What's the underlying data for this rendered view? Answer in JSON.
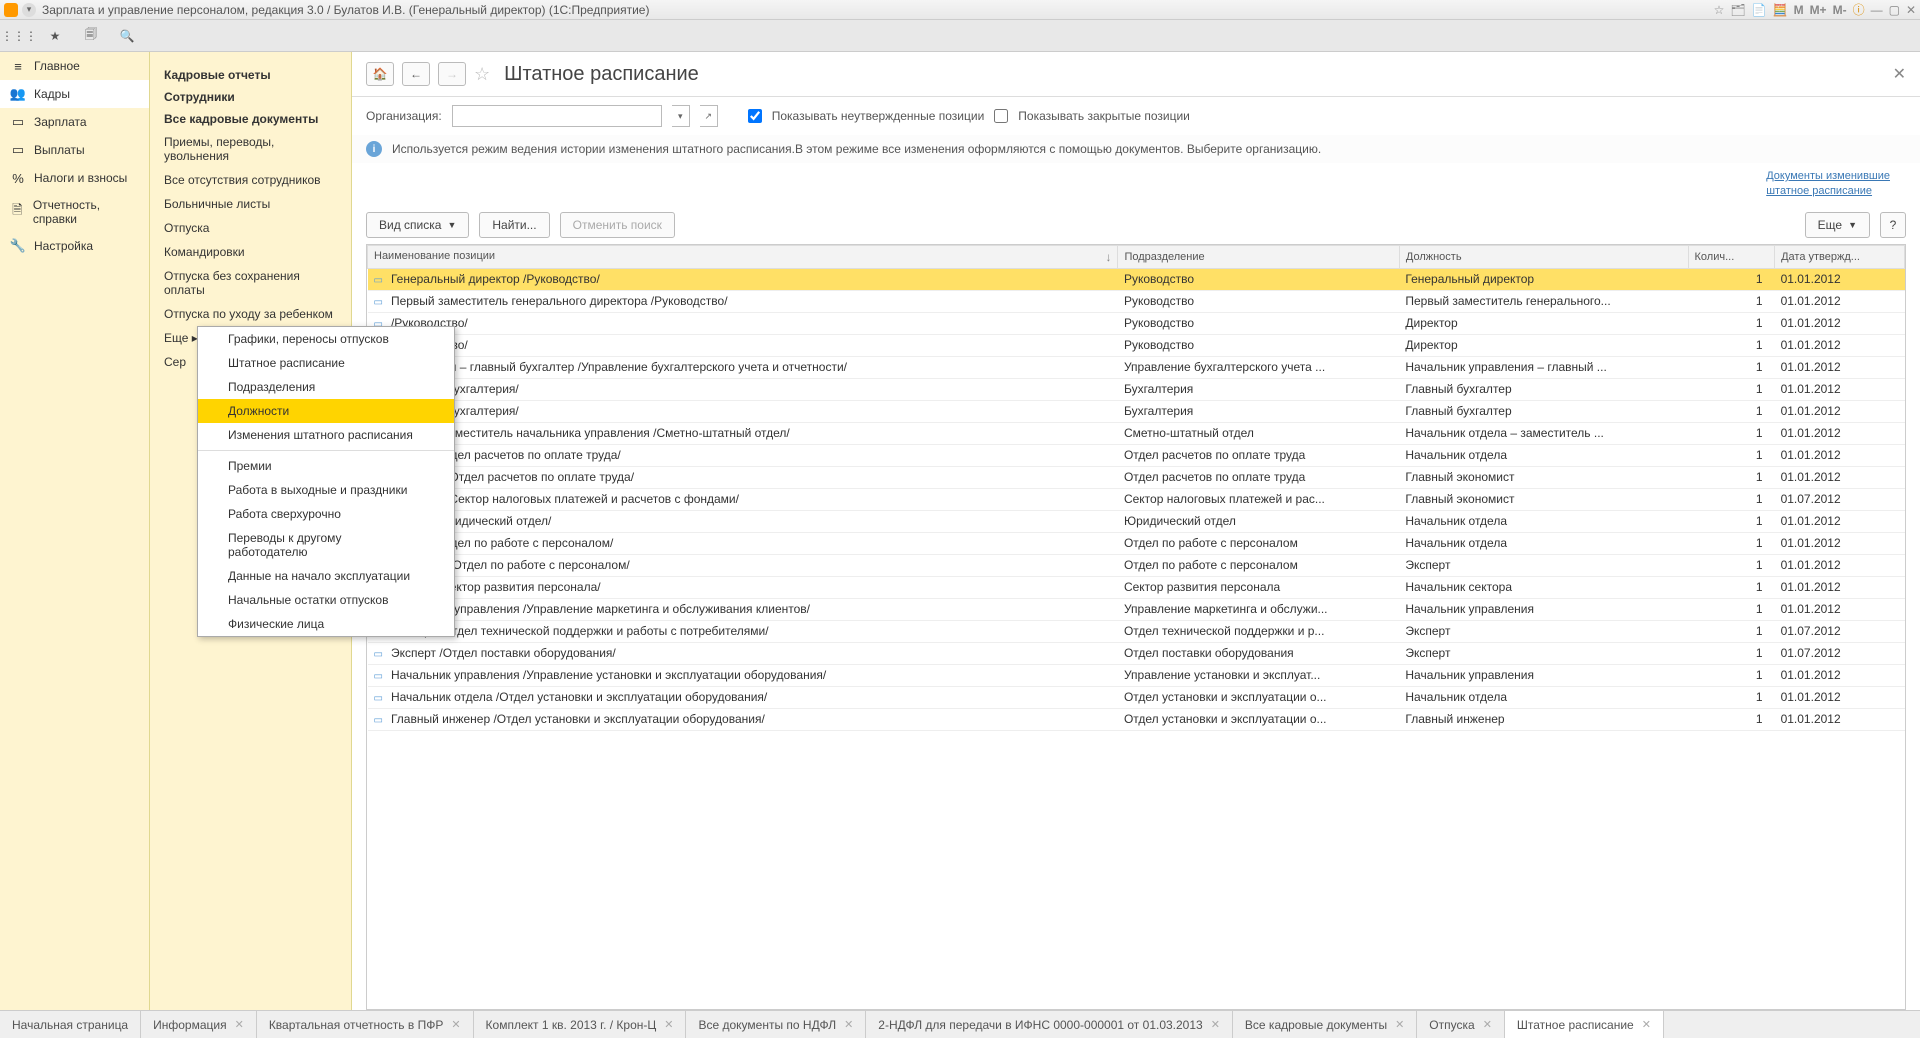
{
  "title": "Зарплата и управление персоналом, редакция 3.0 / Булатов И.В. (Генеральный директор)  (1С:Предприятие)",
  "leftnav": [
    {
      "icon": "≡",
      "label": "Главное"
    },
    {
      "icon": "👥",
      "label": "Кадры"
    },
    {
      "icon": "▭",
      "label": "Зарплата"
    },
    {
      "icon": "▭",
      "label": "Выплаты"
    },
    {
      "icon": "%",
      "label": "Налоги и взносы"
    },
    {
      "icon": "🗎",
      "label": "Отчетность, справки"
    },
    {
      "icon": "🔧",
      "label": "Настройка"
    }
  ],
  "subnav": {
    "headers": [
      "Кадровые отчеты",
      "Сотрудники",
      "Все кадровые документы"
    ],
    "links": [
      "Приемы, переводы, увольнения",
      "Все отсутствия сотрудников",
      "Больничные листы",
      "Отпуска",
      "Командировки",
      "Отпуска без сохранения оплаты",
      "Отпуска по уходу за ребенком",
      "Еще  ▸",
      "Сер"
    ]
  },
  "ctxmenu": {
    "items": [
      "Графики, переносы отпусков",
      "Штатное расписание",
      "Подразделения",
      "Должности",
      "Изменения штатного расписания",
      "—",
      "Премии",
      "Работа в выходные и праздники",
      "Работа сверхурочно",
      "Переводы к другому работодателю",
      "Данные на начало эксплуатации",
      "Начальные остатки отпусков",
      "Физические лица"
    ],
    "highlight": 3
  },
  "page": {
    "title": "Штатное расписание",
    "org_label": "Организация:",
    "show_unapproved": "Показывать неутвержденные позиции",
    "show_closed": "Показывать закрытые позиции",
    "info": "Используется режим ведения истории изменения штатного расписания.В этом режиме все изменения оформляются с помощью документов. Выберите организацию.",
    "doclink": "Документы изменившие\nштатное расписание",
    "btn_view": "Вид списка",
    "btn_find": "Найти...",
    "btn_cancel": "Отменить поиск",
    "btn_more": "Еще",
    "cols": [
      "Наименование позиции",
      "Подразделение",
      "Должность",
      "Колич...",
      "Дата утвержд..."
    ]
  },
  "rows": [
    {
      "name": "Генеральный директор /Руководство/",
      "dept": "Руководство",
      "pos": "Генеральный директор",
      "qty": "1",
      "date": "01.01.2012",
      "sel": true
    },
    {
      "name": "Первый заместитель генерального директора /Руководство/",
      "dept": "Руководство",
      "pos": "Первый заместитель генерального...",
      "qty": "1",
      "date": "01.01.2012"
    },
    {
      "name": "/Руководство/",
      "dept": "Руководство",
      "pos": "Директор",
      "qty": "1",
      "date": "01.01.2012"
    },
    {
      "name": "/Руководство/",
      "dept": "Руководство",
      "pos": "Директор",
      "qty": "1",
      "date": "01.01.2012"
    },
    {
      "name": "управления – главный бухгалтер /Управление бухгалтерского учета и отчетности/",
      "dept": "Управление бухгалтерского учета ...",
      "pos": "Начальник управления – главный ...",
      "qty": "1",
      "date": "01.01.2012"
    },
    {
      "name": "ухгалтер /Бухгалтерия/",
      "dept": "Бухгалтерия",
      "pos": "Главный бухгалтер",
      "qty": "1",
      "date": "01.01.2012"
    },
    {
      "name": "ухгалтер /Бухгалтерия/",
      "dept": "Бухгалтерия",
      "pos": "Главный бухгалтер",
      "qty": "1",
      "date": "01.01.2012"
    },
    {
      "name": "отдела – заместитель начальника управления /Сметно-штатный отдел/",
      "dept": "Сметно-штатный отдел",
      "pos": "Начальник отдела – заместитель ...",
      "qty": "1",
      "date": "01.01.2012"
    },
    {
      "name": "отдела /Отдел расчетов по оплате труда/",
      "dept": "Отдел расчетов по оплате труда",
      "pos": "Начальник отдела",
      "qty": "1",
      "date": "01.01.2012"
    },
    {
      "name": "кономист /Отдел расчетов по оплате труда/",
      "dept": "Отдел расчетов по оплате труда",
      "pos": "Главный экономист",
      "qty": "1",
      "date": "01.01.2012"
    },
    {
      "name": "кономист /Сектор налоговых платежей и расчетов с фондами/",
      "dept": "Сектор налоговых платежей и рас...",
      "pos": "Главный экономист",
      "qty": "1",
      "date": "01.07.2012"
    },
    {
      "name": "отдела /Юридический отдел/",
      "dept": "Юридический отдел",
      "pos": "Начальник отдела",
      "qty": "1",
      "date": "01.01.2012"
    },
    {
      "name": "отдела /Отдел по работе с персоналом/",
      "dept": "Отдел по работе с персоналом",
      "pos": "Начальник отдела",
      "qty": "1",
      "date": "01.01.2012"
    },
    {
      "name": "категории /Отдел по работе с персоналом/",
      "dept": "Отдел по работе с персоналом",
      "pos": "Эксперт",
      "qty": "1",
      "date": "01.01.2012"
    },
    {
      "name": "сектора /Сектор развития персонала/",
      "dept": "Сектор развития персонала",
      "pos": "Начальник сектора",
      "qty": "1",
      "date": "01.01.2012"
    },
    {
      "name": "Начальник управления /Управление маркетинга и обслуживания клиентов/",
      "dept": "Управление маркетинга и обслужи...",
      "pos": "Начальник управления",
      "qty": "1",
      "date": "01.01.2012"
    },
    {
      "name": "Эксперт /Отдел технической поддержки и работы с потребителями/",
      "dept": "Отдел технической поддержки и р...",
      "pos": "Эксперт",
      "qty": "1",
      "date": "01.07.2012"
    },
    {
      "name": "Эксперт /Отдел поставки оборудования/",
      "dept": "Отдел поставки оборудования",
      "pos": "Эксперт",
      "qty": "1",
      "date": "01.07.2012"
    },
    {
      "name": "Начальник управления /Управление установки и эксплуатации оборудования/",
      "dept": "Управление установки и эксплуат...",
      "pos": "Начальник управления",
      "qty": "1",
      "date": "01.01.2012"
    },
    {
      "name": "Начальник отдела /Отдел установки и эксплуатации оборудования/",
      "dept": "Отдел установки и эксплуатации о...",
      "pos": "Начальник отдела",
      "qty": "1",
      "date": "01.01.2012"
    },
    {
      "name": "Главный инженер /Отдел установки и эксплуатации оборудования/",
      "dept": "Отдел установки и эксплуатации о...",
      "pos": "Главный инженер",
      "qty": "1",
      "date": "01.01.2012"
    }
  ],
  "tabs": [
    "Начальная страница",
    "Информация",
    "Квартальная отчетность в ПФР",
    "Комплект 1 кв. 2013 г. / Крон-Ц",
    "Все документы по НДФЛ",
    "2-НДФЛ для передачи в ИФНС 0000-000001 от 01.03.2013",
    "Все кадровые документы",
    "Отпуска",
    "Штатное расписание"
  ]
}
